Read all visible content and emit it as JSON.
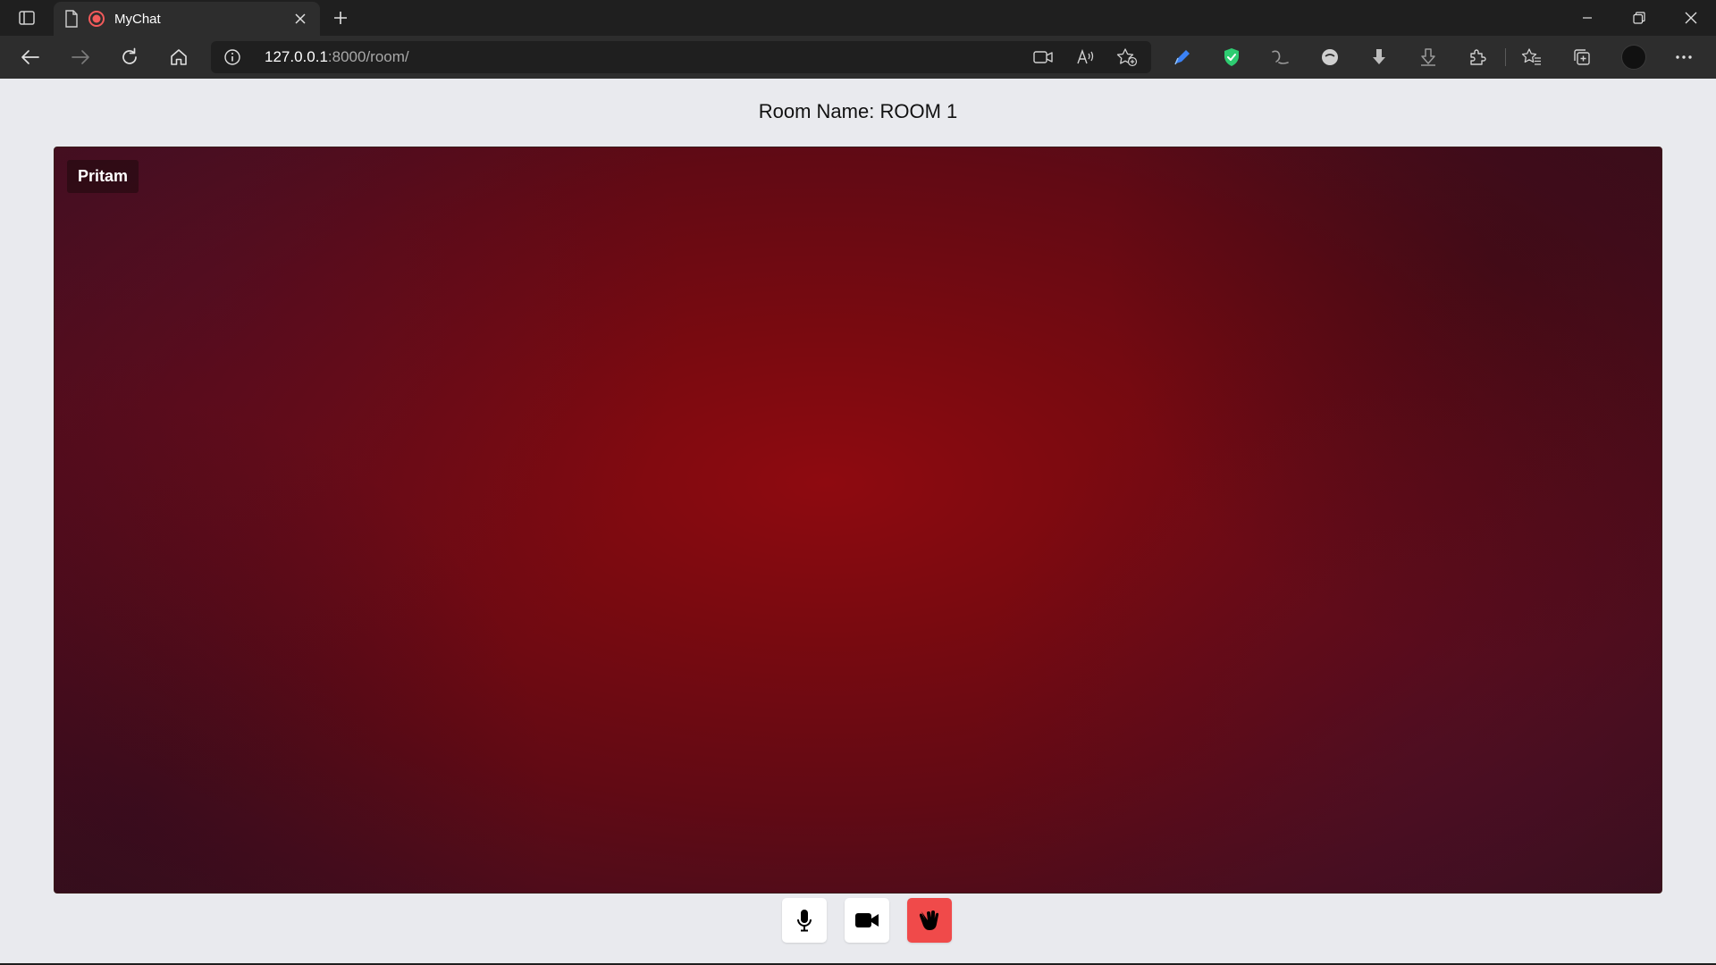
{
  "browser": {
    "tab": {
      "title": "MyChat"
    },
    "address": {
      "host": "127.0.0.1",
      "path": ":8000/room/"
    },
    "colors": {
      "frame": "#1f1f1f",
      "toolbar": "#2d2d2d",
      "shield": "#2ecc71",
      "pen": "#3b82f6"
    }
  },
  "page": {
    "room_title": "Room Name: ROOM 1",
    "participant": {
      "name": "Pritam"
    },
    "controls": {
      "mic": "microphone-icon",
      "camera": "video-camera-icon",
      "leave": "hand-icon",
      "leave_color": "#f04a4a"
    },
    "colors": {
      "background": "#e9eaee",
      "video_tint": "#7a0a10"
    }
  }
}
